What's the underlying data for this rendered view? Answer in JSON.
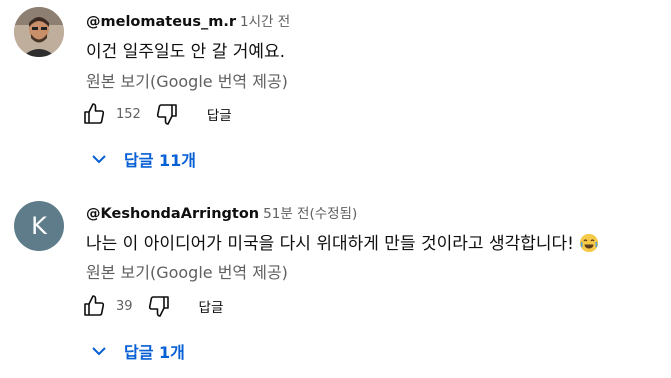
{
  "comments": [
    {
      "author": "@melomateus_m.r",
      "time": "1시간 전",
      "text": "이건 일주일도 안 갈 거예요.",
      "translate": "원본 보기(Google 번역 제공)",
      "likes": "152",
      "reply_label": "답글",
      "replies_label": "답글 11개",
      "avatar": "photo"
    },
    {
      "author": "@KeshondaArrington",
      "time": "51분 전(수정됨)",
      "text": "나는 이 아이디어가 미국을 다시 위대하게 만들 것이라고 생각합니다!",
      "emoji": "laughing-with-tears-emoji",
      "translate": "원본 보기(Google 번역 제공)",
      "likes": "39",
      "reply_label": "답글",
      "replies_label": "답글 1개",
      "avatar": "K"
    }
  ],
  "colors": {
    "link": "#065fd4",
    "secondary": "#606060",
    "avatar_k": "#5f7c8a"
  }
}
